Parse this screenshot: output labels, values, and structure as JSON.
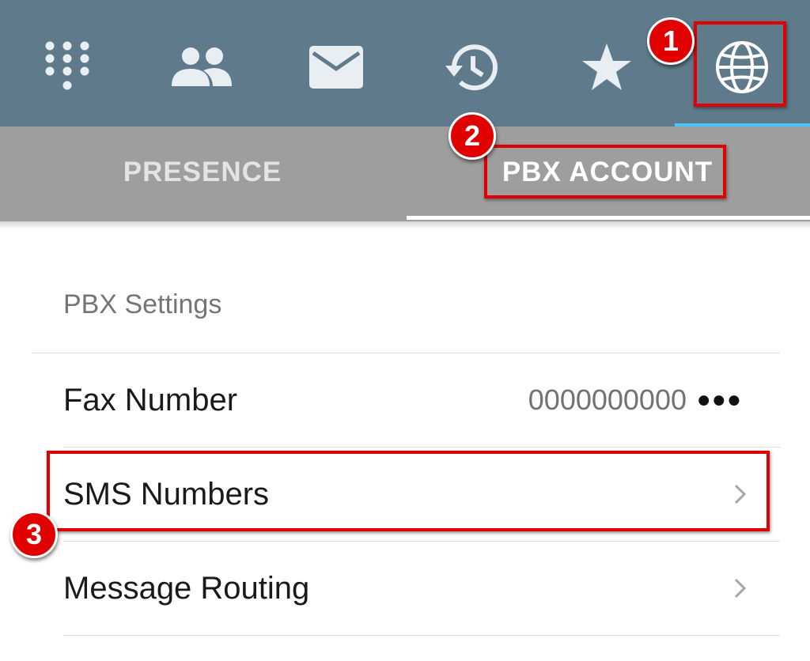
{
  "colors": {
    "topbar": "#5f7b8b",
    "subtabs": "#9e9e9e",
    "active_tab_indicator": "#4fc3f7",
    "annotation_red": "#e10000"
  },
  "top_nav": {
    "icons": [
      "dialpad-icon",
      "contacts-icon",
      "messages-icon",
      "history-icon",
      "favorites-icon",
      "globe-icon"
    ],
    "active": "globe-icon"
  },
  "subtabs": {
    "presence": "PRESENCE",
    "pbx_account": "PBX ACCOUNT",
    "active": "pbx_account"
  },
  "section": {
    "header": "PBX Settings"
  },
  "rows": {
    "fax_number": {
      "label": "Fax Number",
      "value": "0000000000"
    },
    "sms_numbers": {
      "label": "SMS Numbers"
    },
    "message_routing": {
      "label": "Message Routing"
    }
  },
  "callouts": {
    "step1": "1",
    "step2": "2",
    "step3": "3"
  }
}
